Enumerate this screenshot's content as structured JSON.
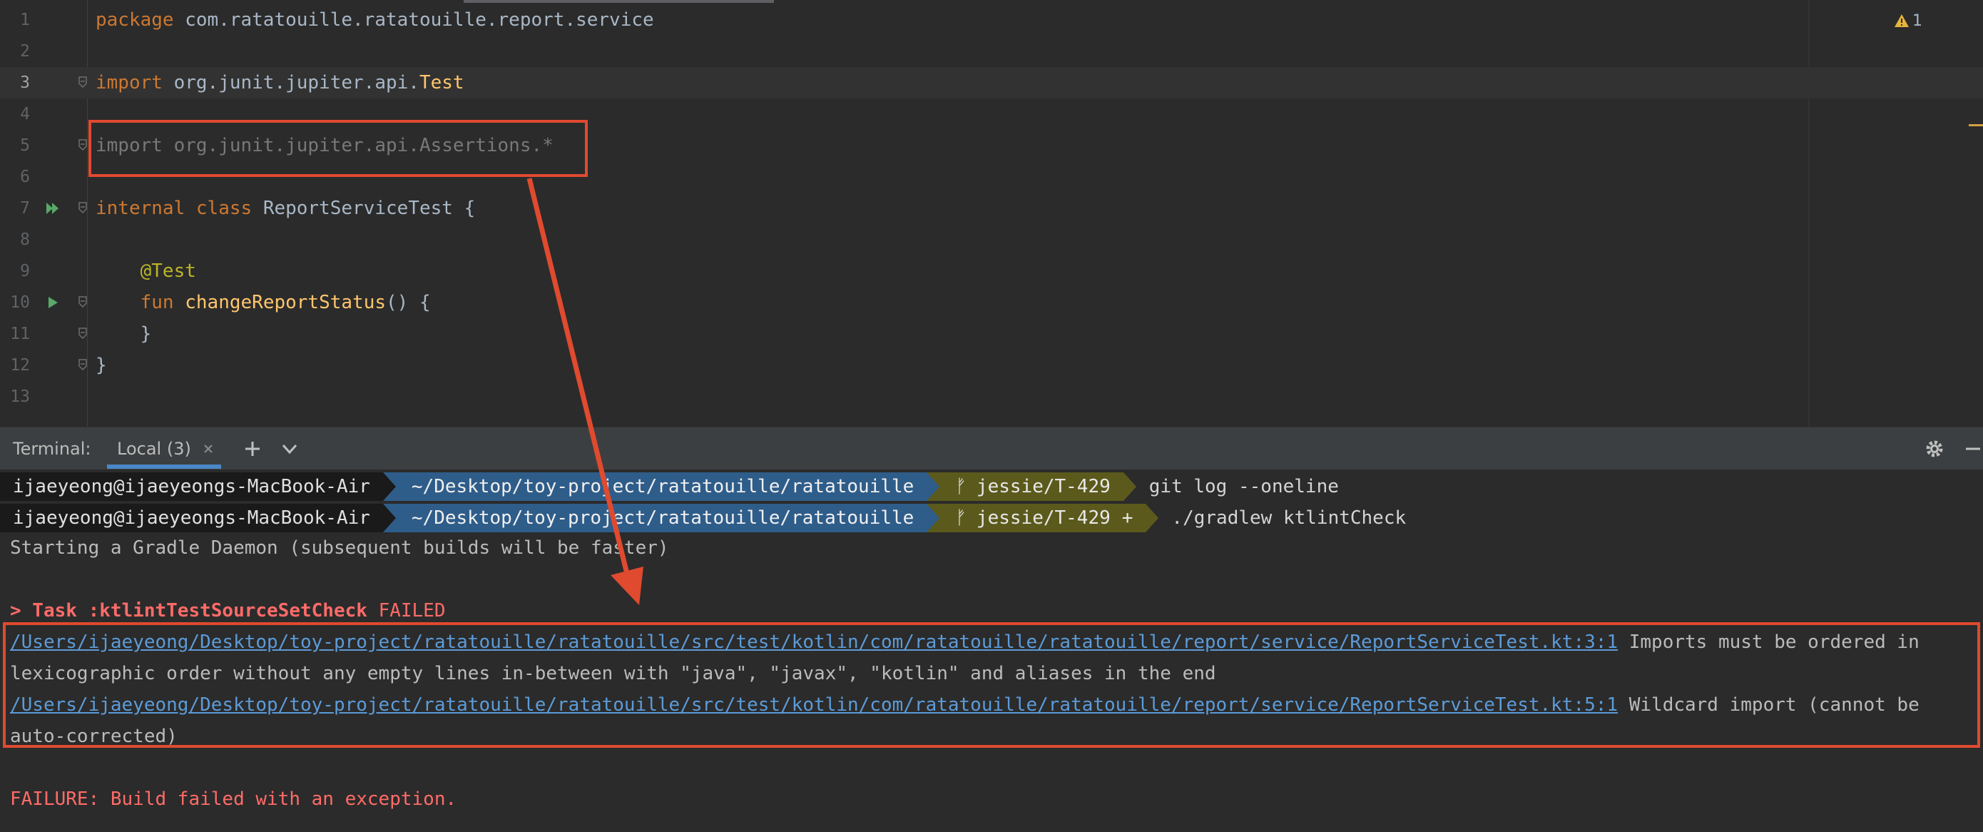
{
  "editor": {
    "lines": [
      {
        "num": "1",
        "parts": [
          {
            "t": "package ",
            "c": "kw"
          },
          {
            "t": "com.ratatouille.ratatouille.report.service",
            "c": ""
          }
        ]
      },
      {
        "num": "2",
        "parts": []
      },
      {
        "num": "3",
        "parts": [
          {
            "t": "import ",
            "c": "kw"
          },
          {
            "t": "org.junit.jupiter.api.",
            "c": ""
          },
          {
            "t": "Test",
            "c": "type"
          }
        ]
      },
      {
        "num": "4",
        "parts": []
      },
      {
        "num": "5",
        "parts": [
          {
            "t": "import org.junit.jupiter.api.Assertions.*",
            "c": "unused"
          }
        ]
      },
      {
        "num": "6",
        "parts": []
      },
      {
        "num": "7",
        "parts": [
          {
            "t": "internal ",
            "c": "kw"
          },
          {
            "t": "class ",
            "c": "kw"
          },
          {
            "t": "ReportServiceTest {",
            "c": ""
          }
        ]
      },
      {
        "num": "8",
        "parts": []
      },
      {
        "num": "9",
        "parts": [
          {
            "t": "    ",
            "c": ""
          },
          {
            "t": "@Test",
            "c": "anno"
          }
        ]
      },
      {
        "num": "10",
        "parts": [
          {
            "t": "    ",
            "c": ""
          },
          {
            "t": "fun ",
            "c": "kw"
          },
          {
            "t": "changeReportStatus",
            "c": "type"
          },
          {
            "t": "() {",
            "c": ""
          }
        ]
      },
      {
        "num": "11",
        "parts": [
          {
            "t": "    }",
            "c": ""
          }
        ]
      },
      {
        "num": "12",
        "parts": [
          {
            "t": "}",
            "c": ""
          }
        ]
      },
      {
        "num": "13",
        "parts": []
      }
    ],
    "current_line": "3",
    "warning_count": "1"
  },
  "terminal": {
    "title": "Terminal:",
    "tab_label": "Local (3)",
    "prompts": [
      {
        "user": "ijaeyeong@ijaeyeongs-MacBook-Air",
        "dir": "~/Desktop/toy-project/ratatouille/ratatouille",
        "branch": "jessie/T-429",
        "dirty": "",
        "command": "git log --oneline"
      },
      {
        "user": "ijaeyeong@ijaeyeongs-MacBook-Air",
        "dir": "~/Desktop/toy-project/ratatouille/ratatouille",
        "branch": "jessie/T-429",
        "dirty": "+",
        "command": "./gradlew ktlintCheck"
      }
    ],
    "daemon_msg": "Starting a Gradle Daemon (subsequent builds will be faster)",
    "task_prefix": "> Task :ktlintTestSourceSetCheck",
    "task_status": "FAILED",
    "errors": [
      {
        "path": "/Users/ijaeyeong/Desktop/toy-project/ratatouille/ratatouille/src/test/kotlin/com/ratatouille/ratatouille/report/service/ReportServiceTest.kt:3:1",
        "msg_1": " Imports must be ordered in",
        "msg_2": "lexicographic order without any empty lines in-between with \"java\", \"javax\", \"kotlin\" and aliases in the end"
      },
      {
        "path": "/Users/ijaeyeong/Desktop/toy-project/ratatouille/ratatouille/src/test/kotlin/com/ratatouille/ratatouille/report/service/ReportServiceTest.kt:5:1",
        "msg_1": " Wildcard import (cannot be",
        "msg_2": "auto-corrected)"
      }
    ],
    "failure_msg": "FAILURE: Build failed with an exception."
  },
  "colors": {
    "annotation_red": "#e04a2f",
    "editor_bg": "#2b2b2b",
    "keyword": "#cc7832",
    "link": "#5c9bd8",
    "error_text": "#ff6b68"
  },
  "icons": [
    "run-icon",
    "run-double-icon",
    "fold-icon",
    "warning-icon",
    "close-icon",
    "plus-icon",
    "chevron-down-icon",
    "gear-icon",
    "minimize-icon"
  ]
}
